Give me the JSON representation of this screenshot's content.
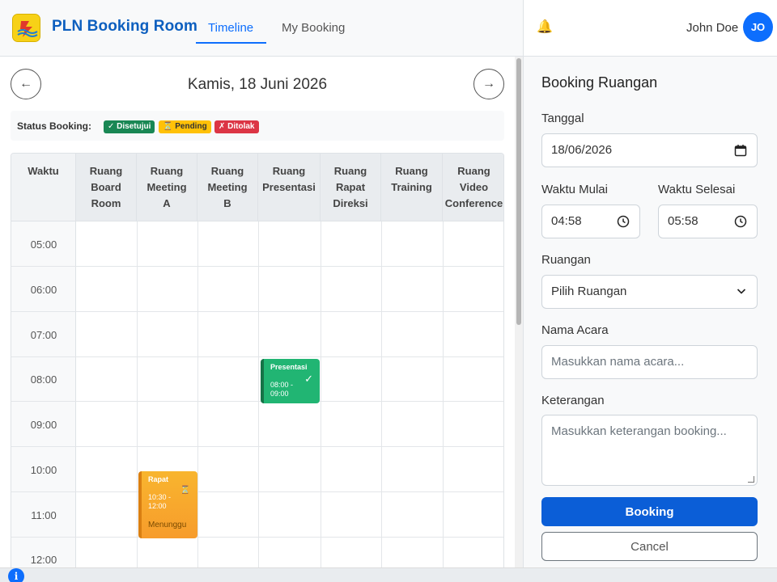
{
  "app": {
    "brand": "PLN Booking Room",
    "logo": "pln-logo"
  },
  "nav": {
    "tabs": [
      {
        "label": "Timeline",
        "active": true
      },
      {
        "label": "My Booking",
        "active": false
      }
    ]
  },
  "user": {
    "name": "John Doe",
    "initials": "JO",
    "notification_icon": "bell-icon"
  },
  "timeline": {
    "prev_label": "←",
    "next_label": "→",
    "date_title": "Kamis, 18 Juni 2026",
    "status_label": "Status Booking:",
    "statuses": [
      {
        "label": "✓ Disetujui",
        "color": "#198754"
      },
      {
        "label": "⏳ Pending",
        "color": "#ffc107"
      },
      {
        "label": "✗ Ditolak",
        "color": "#dc3545"
      }
    ],
    "time_header": "Waktu",
    "rooms": [
      [
        "Ruang",
        "Board",
        "Room"
      ],
      [
        "Ruang",
        "Meeting",
        "A"
      ],
      [
        "Ruang",
        "Meeting",
        "B"
      ],
      [
        "Ruang",
        "Presentasi"
      ],
      [
        "Ruang",
        "Rapat",
        "Direksi"
      ],
      [
        "Ruang",
        "Training"
      ],
      [
        "Ruang",
        "Video",
        "Conference"
      ]
    ],
    "times": [
      "05:00",
      "06:00",
      "07:00",
      "08:00",
      "09:00",
      "10:00",
      "11:00",
      "12:00"
    ],
    "events": [
      {
        "title": "Presentasi",
        "time": "08:00 - 09:00",
        "status": "approved",
        "room": "Ruang Presentasi",
        "status_icon": "check-icon"
      },
      {
        "title": "Rapat",
        "time": "10:30 - 12:00",
        "status": "pending",
        "room": "Ruang Meeting A",
        "status_icon": "hourglass-icon",
        "status_text": "Menunggu"
      }
    ]
  },
  "form": {
    "title": "Booking Ruangan",
    "date_label": "Tanggal",
    "date_value": "18/06/2026",
    "start_label": "Waktu Mulai",
    "start_value": "04:58",
    "end_label": "Waktu Selesai",
    "end_value": "05:58",
    "room_label": "Ruangan",
    "room_value": "Pilih Ruangan",
    "event_label": "Nama Acara",
    "event_placeholder": "Masukkan nama acara...",
    "notes_label": "Keterangan",
    "notes_placeholder": "Masukkan keterangan booking...",
    "submit_label": "Booking",
    "cancel_label": "Cancel"
  },
  "colors": {
    "primary": "#0d6efd",
    "brand": "#0d5fbf",
    "approved": "#21b573",
    "pending": "#f8b52e",
    "rejected": "#dc3545"
  }
}
